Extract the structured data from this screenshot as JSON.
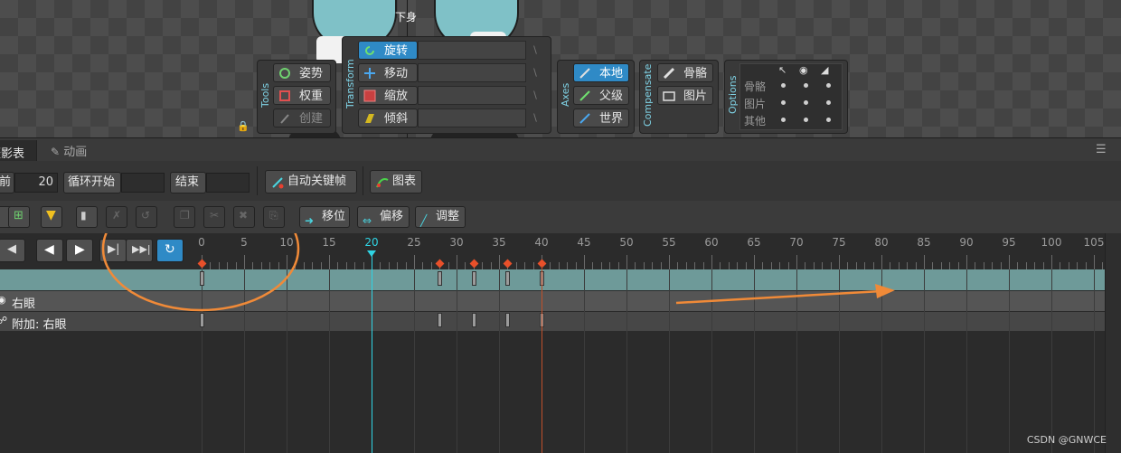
{
  "viewport": {
    "bone_label": "下身",
    "tools": {
      "group_label": "Tools",
      "items": [
        {
          "label": "姿势",
          "state": "normal"
        },
        {
          "label": "权重",
          "state": "normal"
        },
        {
          "label": "创建",
          "state": "disabled"
        }
      ]
    },
    "transform": {
      "group_label": "Transform",
      "items": [
        {
          "label": "旋转",
          "state": "active"
        },
        {
          "label": "移动",
          "state": "normal"
        },
        {
          "label": "缩放",
          "state": "normal"
        },
        {
          "label": "倾斜",
          "state": "normal"
        }
      ]
    },
    "axes": {
      "group_label": "Axes",
      "items": [
        {
          "label": "本地",
          "state": "active"
        },
        {
          "label": "父级",
          "state": "normal"
        },
        {
          "label": "世界",
          "state": "normal"
        }
      ]
    },
    "compensate": {
      "group_label": "Compensate",
      "items": [
        {
          "label": "骨骼"
        },
        {
          "label": "图片"
        }
      ]
    },
    "options": {
      "group_label": "Options",
      "rows": [
        "骨骼",
        "图片",
        "其他"
      ]
    }
  },
  "panel": {
    "tabs": [
      {
        "label": "摄影表",
        "active": true
      },
      {
        "label": "动画",
        "active": false
      }
    ],
    "toolbar": {
      "before_label": "前",
      "before_value": "20",
      "loop_start_label": "循环开始",
      "loop_start_value": "",
      "end_label": "结束",
      "end_value": "",
      "autokey_label": "自动关键帧",
      "graph_label": "图表"
    },
    "edit_toolbar": {
      "shift_label": "移位",
      "offset_label": "偏移",
      "adjust_label": "调整"
    },
    "timeline": {
      "ruler_ticks": [
        "0",
        "5",
        "10",
        "15",
        "20",
        "25",
        "30",
        "35",
        "40",
        "45",
        "50",
        "55",
        "60",
        "65",
        "70",
        "75",
        "80",
        "85",
        "90",
        "95",
        "100",
        "105"
      ],
      "current_frame": 20,
      "key_frames": [
        0,
        28,
        32,
        36,
        40
      ],
      "rows": [
        {
          "label": ""
        },
        {
          "label": "右眼"
        },
        {
          "label": "附加: 右眼"
        }
      ]
    }
  },
  "colors": {
    "accent": "#2f8ac6",
    "selected_row": "#6e9a99",
    "playhead": "#2fd4e4",
    "keyframe_marker": "#e8502a",
    "annotation": "#f08a38"
  },
  "watermark": "CSDN @GNWCE"
}
